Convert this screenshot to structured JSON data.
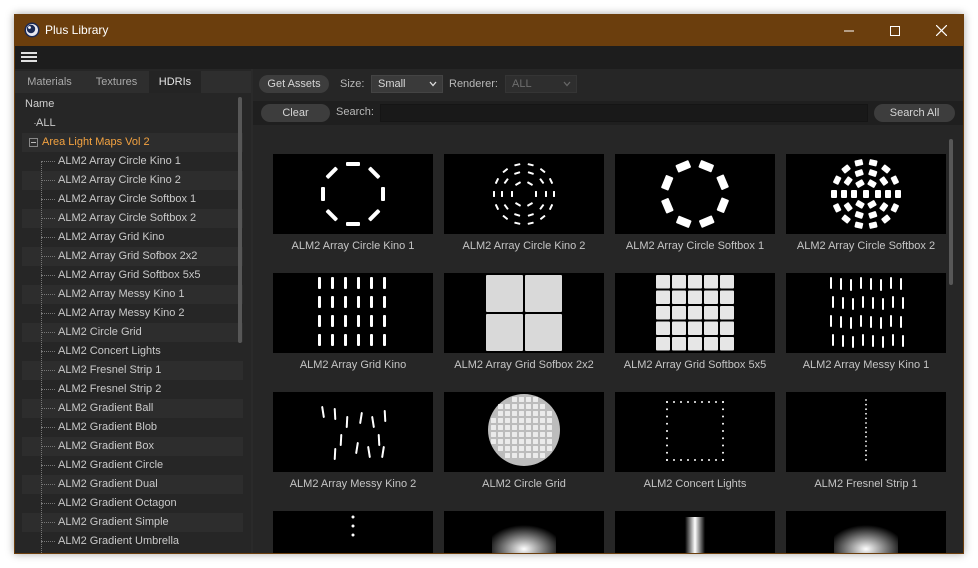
{
  "window": {
    "title": "Plus Library"
  },
  "menu": {
    "icon": "hamburger-menu-icon"
  },
  "tabs": [
    "Materials",
    "Textures",
    "HDRIs"
  ],
  "active_tab": "HDRIs",
  "tree": {
    "header": "Name",
    "root": "ALL",
    "folder": "Area Light Maps Vol 2",
    "items": [
      "ALM2 Array Circle Kino 1",
      "ALM2 Array Circle Kino 2",
      "ALM2 Array Circle Softbox 1",
      "ALM2 Array Circle Softbox 2",
      "ALM2 Array Grid Kino",
      "ALM2 Array Grid Sofbox 2x2",
      "ALM2 Array Grid Softbox 5x5",
      "ALM2 Array Messy Kino 1",
      "ALM2 Array Messy Kino 2",
      "ALM2 Circle Grid",
      "ALM2 Concert Lights",
      "ALM2 Fresnel Strip 1",
      "ALM2 Fresnel Strip 2",
      "ALM2 Gradient Ball",
      "ALM2 Gradient Blob",
      "ALM2 Gradient Box",
      "ALM2 Gradient Circle",
      "ALM2 Gradient Dual",
      "ALM2 Gradient Octagon",
      "ALM2 Gradient Simple",
      "ALM2 Gradient Umbrella"
    ]
  },
  "toolbar": {
    "get_assets": "Get Assets",
    "size_label": "Size:",
    "size_value": "Small",
    "renderer_label": "Renderer:",
    "renderer_value": "ALL",
    "clear": "Clear",
    "search_label": "Search:",
    "search_value": "",
    "search_all": "Search All"
  },
  "grid": [
    "ALM2 Array Circle Kino 1",
    "ALM2 Array Circle Kino 2",
    "ALM2 Array Circle Softbox 1",
    "ALM2 Array Circle Softbox 2",
    "ALM2 Array Grid Kino",
    "ALM2 Array Grid Sofbox 2x2",
    "ALM2 Array Grid Softbox 5x5",
    "ALM2 Array Messy Kino 1",
    "ALM2 Array Messy Kino 2",
    "ALM2 Circle Grid",
    "ALM2 Concert Lights",
    "ALM2 Fresnel Strip 1",
    "",
    "",
    "",
    ""
  ],
  "colors": {
    "titlebar": "#6b3e0d",
    "folder_text": "#f3a240",
    "panel": "#262626"
  }
}
